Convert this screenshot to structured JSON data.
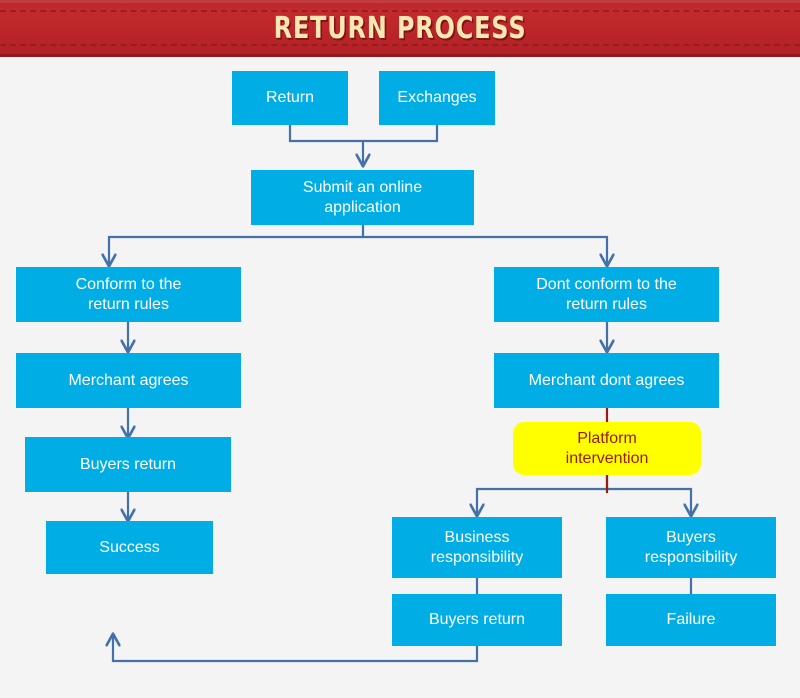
{
  "header": {
    "title": "RETURN PROCESS",
    "background_color": "#bc2529",
    "title_color": "#fbe7b2"
  },
  "canvas": {
    "background_color": "#f4f4f4",
    "node_color": "#00aee5",
    "node_text_color": "#ffffff",
    "highlight_color": "#ffff00",
    "highlight_text_color": "#9b1a10",
    "connector_color": "#4472a8",
    "escalation_connector_color": "#9b1a10"
  },
  "nodes": {
    "return": "Return",
    "exchanges": "Exchanges",
    "submit": "Submit an online\napplication",
    "submit_line1": "Submit an online",
    "submit_line2": "application",
    "conform_line1": "Conform to the",
    "conform_line2": "return rules",
    "merchant_agrees": "Merchant agrees",
    "buyers_return_left": "Buyers return",
    "success": "Success",
    "dont_conform_line1": "Dont conform to the",
    "dont_conform_line2": "return rules",
    "merchant_dont_agrees": "Merchant dont agrees",
    "platform_line1": "Platform",
    "platform_line2": "intervention",
    "business_resp_line1": "Business",
    "business_resp_line2": "responsibility",
    "buyers_resp_line1": "Buyers",
    "buyers_resp_line2": "responsibility",
    "buyers_return_right": "Buyers return",
    "failure": "Failure"
  }
}
